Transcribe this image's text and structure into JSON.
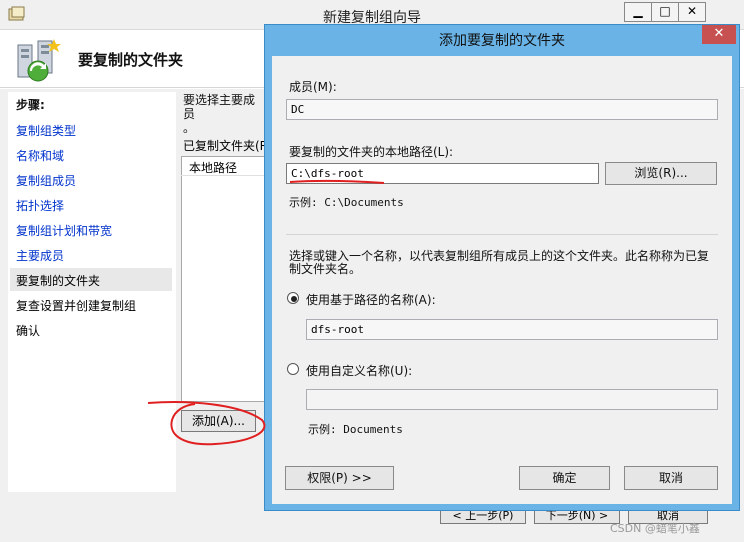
{
  "wizard": {
    "title": "新建复制组向导",
    "header_title": "要复制的文件夹",
    "steps_label": "步骤:",
    "steps": [
      "复制组类型",
      "名称和域",
      "复制组成员",
      "拓扑选择",
      "复制组计划和带宽",
      "主要成员",
      "要复制的文件夹",
      "复查设置并创建复制组",
      "确认"
    ],
    "current_step": "要复制的文件夹",
    "intro_text": "要选择主要成员",
    "intro_text_2": "。",
    "folders_label": "已复制文件夹(R",
    "folders_column": "本地路径",
    "add_button": "添加(A)...",
    "nav_prev": "< 上一步(P)",
    "nav_next": "下一步(N) >",
    "nav_cancel": "取消",
    "caption_min": "▁",
    "caption_max": "□",
    "caption_close": "✕"
  },
  "dialog": {
    "title": "添加要复制的文件夹",
    "close": "✕",
    "member_label": "成员(M):",
    "member_value": "DC",
    "local_path_label": "要复制的文件夹的本地路径(L):",
    "local_path_value": "C:\\dfs-root",
    "browse_button": "浏览(R)...",
    "path_example": "示例: C:\\Documents",
    "name_instructions": "选择或键入一个名称，以代表复制组所有成员上的这个文件夹。此名称称为已复制文件夹名。",
    "radio_path_label": "使用基于路径的名称(A):",
    "radio_path_value": "dfs-root",
    "radio_custom_label": "使用自定义名称(U):",
    "radio_custom_value": "",
    "name_example": "示例: Documents",
    "permissions_button": "权限(P) >>",
    "ok_button": "确定",
    "cancel_button": "取消"
  },
  "watermark": "CSDN @蜡笔小鑫",
  "colors": {
    "annotation_red": "#e02020",
    "dialog_frame": "#69b3e7",
    "close_red": "#c75050",
    "link_blue": "#0033cc"
  }
}
